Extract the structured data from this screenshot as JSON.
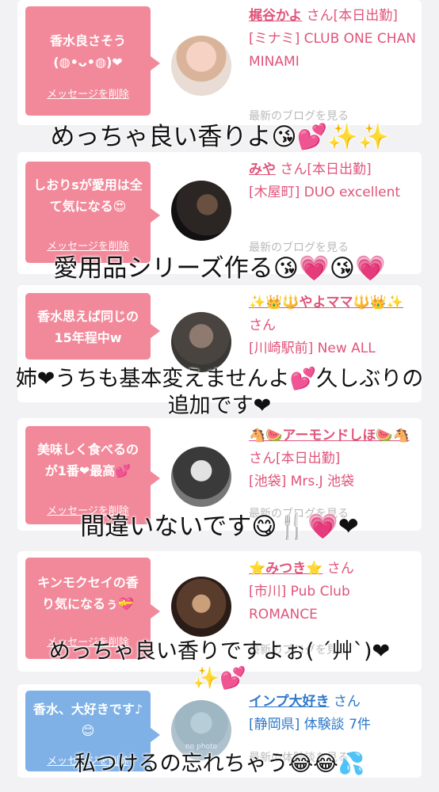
{
  "cards": [
    {
      "message": "香水良さそう(◍•ᴗ•◍)❤",
      "delete_label": "メッセージを削除",
      "name": "梶谷かよ",
      "suffix": "さん[本日出勤]",
      "shop": "[ミナミ] CLUB ONE CHAN MINAMI",
      "blog_link": "最新のブログを見る",
      "color": "#f2899a"
    },
    {
      "message": "しおりsが愛用は全て気になる😍",
      "delete_label": "メッセージを削除",
      "name": "みや",
      "suffix": "さん[本日出勤]",
      "shop": "[木屋町] DUO excellent",
      "blog_link": "最新のブログを見る",
      "color": "#f2899a"
    },
    {
      "message": "香水思えば同じの15年程中w",
      "delete_label": "メッセージを削除",
      "name": "✨👑🔱やよママ🔱👑✨",
      "suffix": "さん",
      "shop": "[川崎駅前] New ALL",
      "blog_link": "",
      "color": "#f2899a"
    },
    {
      "message": "美味しく食べるのが1番❤最高💕",
      "delete_label": "メッセージを削除",
      "name": "🐴🍉アーモンドしほ🍉🐴",
      "suffix": "さん[本日出勤]",
      "shop": "[池袋] Mrs.J 池袋",
      "blog_link": "最新のブログを見る",
      "color": "#f2899a"
    },
    {
      "message": "キンモクセイの香り気になるぅ💝",
      "delete_label": "メッセージを削除",
      "name": "⭐みつき⭐",
      "suffix": "さん",
      "shop": "[市川] Pub Club ROMANCE",
      "blog_link": "最新のブログを見る",
      "color": "#f2899a"
    },
    {
      "message": "香水、大好きです♪😊",
      "delete_label": "メッセージを削除",
      "name": "インプ大好き",
      "suffix": "さん",
      "shop": "[静岡県] 体験談 7件",
      "blog_link": "最新の体験談を見る",
      "avatar_text": "no photo",
      "color": "#7fb1e6"
    }
  ],
  "captions": [
    "めっちゃ良い香りよ😘💕✨✨",
    "愛用品シリーズ作る😘💗😘💗",
    "姉❤うちも基本変えませんよ💕久しぶりの追加です❤",
    "間違いないです😋🍴💗❤",
    "めっちゃ良い香りですよぉ( ´艸`)❤✨💕",
    "私つけるの忘れちゃう😂😂💦"
  ]
}
